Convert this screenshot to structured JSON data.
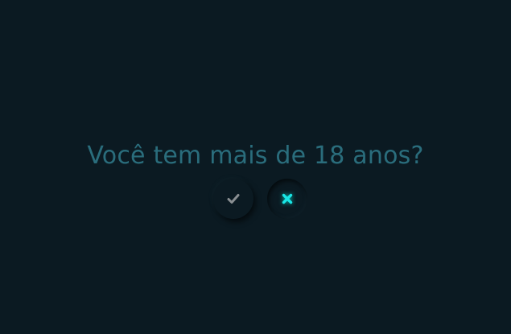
{
  "prompt": {
    "question": "Você tem mais de 18 anos?"
  },
  "buttons": [
    {
      "name": "yes",
      "icon": "check-icon",
      "color": "#8a8f92",
      "state": "normal"
    },
    {
      "name": "no",
      "icon": "x-icon",
      "color": "#19e6e6",
      "state": "pressed"
    }
  ],
  "colors": {
    "background": "#0b1a22",
    "question_text": "#2a6d7c",
    "accent": "#19e6e6"
  }
}
